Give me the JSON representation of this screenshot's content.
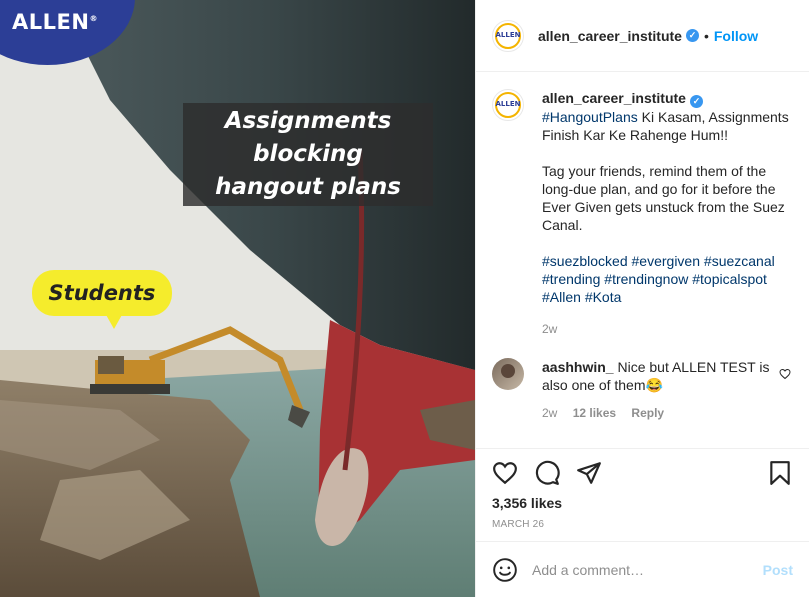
{
  "image": {
    "brand_logo_text": "ALLEN",
    "brand_logo_mark": "®",
    "caption_line1": "Assignments blocking",
    "caption_line2": "hangout plans",
    "bubble_text": "Students"
  },
  "header": {
    "avatar_text": "ALLEN",
    "username": "allen_career_institute",
    "verified_glyph": "✓",
    "separator": "•",
    "follow_label": "Follow"
  },
  "caption": {
    "username": "allen_career_institute",
    "hashtag_lead": "#HangoutPlans",
    "line1_rest": " Ki Kasam, Assignments Finish Kar Ke Rahenge Hum!!",
    "para2": "Tag your friends, remind them of the long-due plan, and go for it before the Ever Given gets unstuck from the Suez Canal.",
    "hashtags": [
      "#suezblocked",
      "#evergiven",
      "#suezcanal",
      "#trending",
      "#trendingnow",
      "#topicalspot",
      "#Allen",
      "#Kota"
    ],
    "time_ago": "2w"
  },
  "comment": {
    "username": "aashhwin_",
    "text": " Nice but ALLEN TEST is also one of them😂",
    "time_ago": "2w",
    "likes": "12 likes",
    "reply_label": "Reply"
  },
  "actions": {
    "icons": [
      "heart-icon",
      "comment-icon",
      "share-icon",
      "bookmark-icon"
    ],
    "likes": "3,356 likes",
    "date": "MARCH 26"
  },
  "add_comment": {
    "placeholder": "Add a comment…",
    "post_label": "Post"
  },
  "colors": {
    "brand_blue": "#2c3e96",
    "link_blue": "#0095f6",
    "hashtag": "#00376b",
    "bubble_yellow": "#f5ec2c",
    "post_disabled": "#b2dffc"
  }
}
